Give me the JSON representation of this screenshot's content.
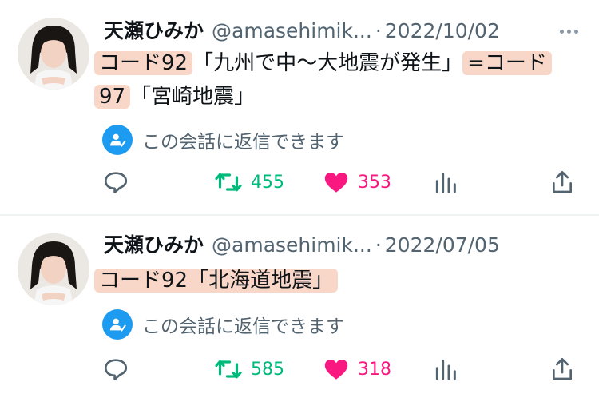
{
  "tweets": [
    {
      "name": "天瀬ひみか",
      "handle": "@amasehimik...",
      "dot": "·",
      "date": "2022/10/02",
      "text": {
        "code1": "コード92",
        "quote1": "「九州で中〜大地震が発生」",
        "eq_code2_part1": "=コード",
        "code2_part2": "97",
        "quote2": "「宮崎地震」"
      },
      "reply_notice": "この会話に返信できます",
      "retweets": "455",
      "likes": "353"
    },
    {
      "name": "天瀬ひみか",
      "handle": "@amasehimik...",
      "dot": "·",
      "date": "2022/07/05",
      "text": {
        "code1": "コード92「北海道地震」"
      },
      "reply_notice": "この会話に返信できます",
      "retweets": "585",
      "likes": "318"
    }
  ],
  "colors": {
    "retweet": "#00ba7c",
    "like": "#f91880",
    "badge": "#1d9bf0",
    "highlight": "#f8d7c8",
    "muted": "#536471"
  },
  "icons": [
    "reply-icon",
    "retweet-icon",
    "like-heart-icon",
    "views-bar-icon",
    "share-icon",
    "more-dots-icon",
    "reply-permission-icon"
  ]
}
